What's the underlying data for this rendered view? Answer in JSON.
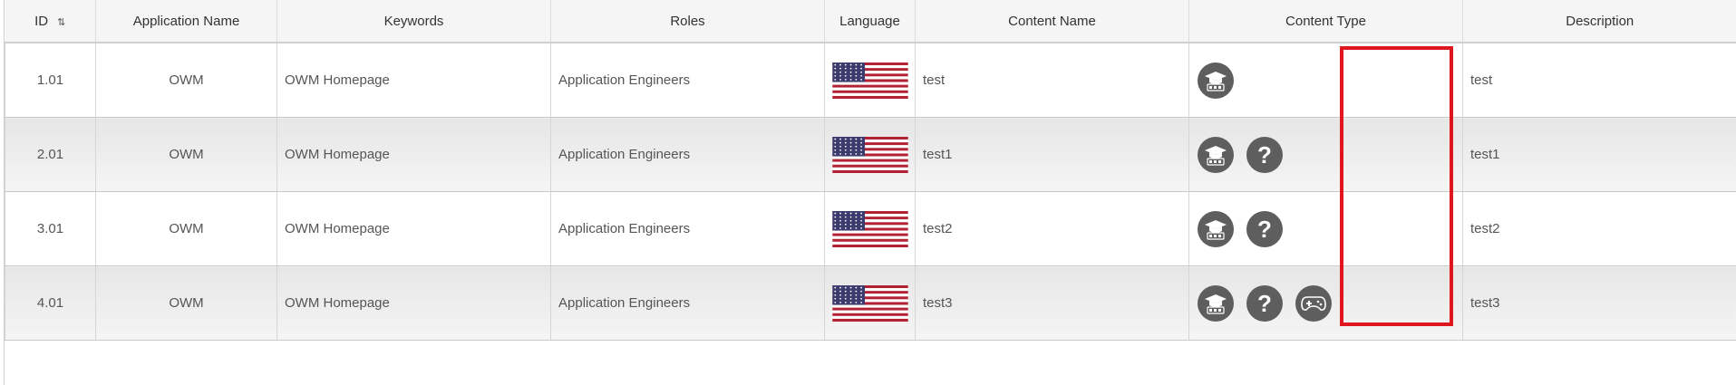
{
  "table": {
    "headers": [
      "ID",
      "Application Name",
      "Keywords",
      "Roles",
      "Language",
      "Content Name",
      "Content Type",
      "Description"
    ],
    "rows": [
      {
        "id": "1.01",
        "app": "OWM",
        "keywords": "OWM Homepage",
        "roles": "Application Engineers",
        "language": "us-flag",
        "content_name": "test",
        "content_types": [
          "training-icon"
        ],
        "description": "test"
      },
      {
        "id": "2.01",
        "app": "OWM",
        "keywords": "OWM Homepage",
        "roles": "Application Engineers",
        "language": "us-flag",
        "content_name": "test1",
        "content_types": [
          "training-icon",
          "help-icon"
        ],
        "description": "test1"
      },
      {
        "id": "3.01",
        "app": "OWM",
        "keywords": "OWM Homepage",
        "roles": "Application Engineers",
        "language": "us-flag",
        "content_name": "test2",
        "content_types": [
          "training-icon",
          "help-icon"
        ],
        "description": "test2"
      },
      {
        "id": "4.01",
        "app": "OWM",
        "keywords": "OWM Homepage",
        "roles": "Application Engineers",
        "language": "us-flag",
        "content_name": "test3",
        "content_types": [
          "training-icon",
          "help-icon",
          "gamepad-icon"
        ],
        "description": "test3"
      }
    ]
  },
  "help_glyph": "?",
  "colors": {
    "highlight": "#e0161e",
    "icon_bg": "#5e5e5e",
    "header_bg": "#f5f5f5"
  }
}
